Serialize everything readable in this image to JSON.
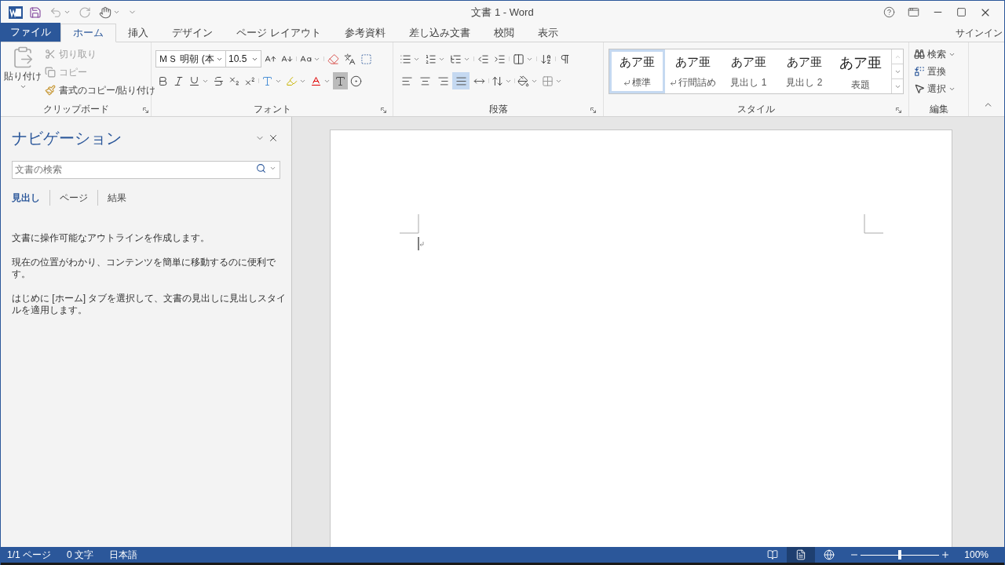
{
  "title": "文書 1 - Word",
  "tabs": [
    {
      "label": "ファイル",
      "kind": "file",
      "selected": false
    },
    {
      "label": "ホーム",
      "kind": "tab",
      "selected": true
    },
    {
      "label": "挿入",
      "kind": "tab",
      "selected": false
    },
    {
      "label": "デザイン",
      "kind": "tab",
      "selected": false
    },
    {
      "label": "ページ レイアウト",
      "kind": "tab",
      "selected": false
    },
    {
      "label": "参考資料",
      "kind": "tab",
      "selected": false
    },
    {
      "label": "差し込み文書",
      "kind": "tab",
      "selected": false
    },
    {
      "label": "校閲",
      "kind": "tab",
      "selected": false
    },
    {
      "label": "表示",
      "kind": "tab",
      "selected": false
    }
  ],
  "signin": "サインイン",
  "clipboard": {
    "paste": "貼り付け",
    "cut": {
      "label": "切り取り",
      "disabled": true
    },
    "copy": {
      "label": "コピー",
      "disabled": true
    },
    "format_painter": "書式のコピー/貼り付け",
    "group": "クリップボード"
  },
  "font": {
    "name": "ＭＳ 明朝 (本",
    "size": "10.5",
    "group": "フォント"
  },
  "paragraph": {
    "group": "段落",
    "align": [
      {
        "selected": false
      },
      {
        "selected": false
      },
      {
        "selected": false
      },
      {
        "selected": true
      },
      {
        "selected": false
      }
    ]
  },
  "styles": {
    "group": "スタイル",
    "items": [
      {
        "preview": "あア亜",
        "name": "標準",
        "mark": true,
        "selected": true
      },
      {
        "preview": "あア亜",
        "name": "行間詰め",
        "mark": true,
        "selected": false
      },
      {
        "preview": "あア亜",
        "name": "見出し 1",
        "mark": false,
        "selected": false
      },
      {
        "preview": "あア亜",
        "name": "見出し 2",
        "mark": false,
        "selected": false
      },
      {
        "preview": "あア亜",
        "name": "表題",
        "mark": false,
        "selected": false
      }
    ]
  },
  "editing": {
    "group": "編集",
    "find": "検索",
    "replace": "置換",
    "select": "選択"
  },
  "navigation": {
    "title": "ナビゲーション",
    "search_placeholder": "文書の検索",
    "tabs": [
      {
        "label": "見出し",
        "selected": true
      },
      {
        "label": "ページ",
        "selected": false
      },
      {
        "label": "結果",
        "selected": false
      }
    ],
    "paragraphs": [
      "文書に操作可能なアウトラインを作成します。",
      "現在の位置がわかり、コンテンツを簡単に移動するのに便利です。",
      "はじめに [ホーム] タブを選択して、文書の見出しに見出しスタイルを適用します。"
    ]
  },
  "status_bar": {
    "page": "1/1 ページ",
    "words": "0 文字",
    "language": "日本語",
    "views": [
      {
        "selected": false
      },
      {
        "selected": true
      },
      {
        "selected": false
      }
    ],
    "zoom": {
      "level": 0.5,
      "reading": "100%"
    }
  }
}
